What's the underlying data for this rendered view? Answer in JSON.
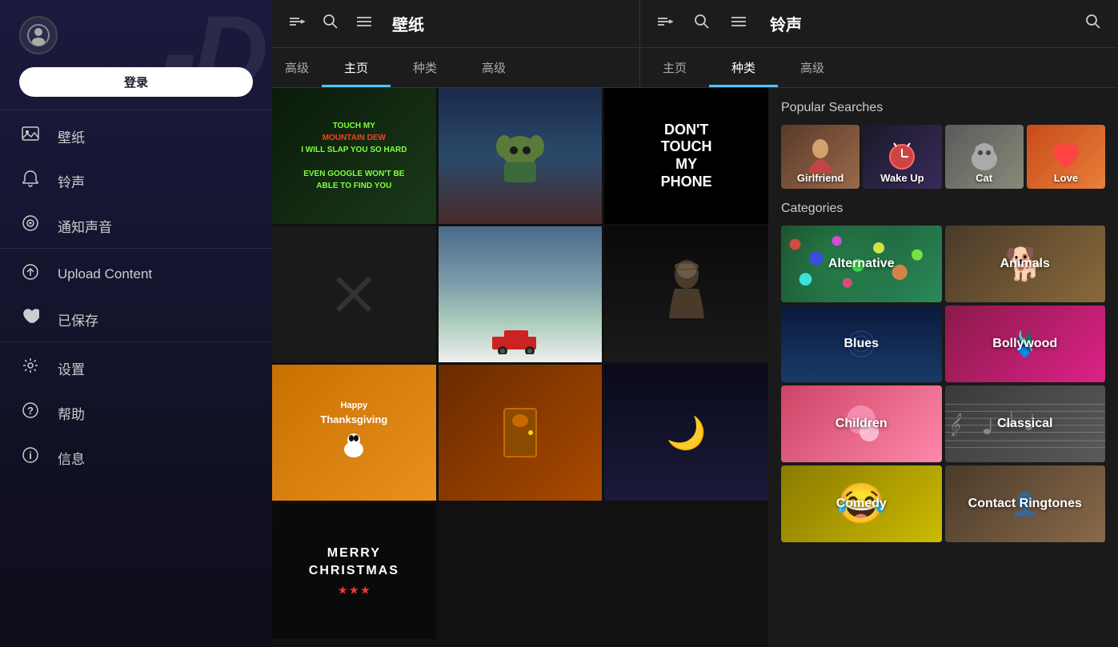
{
  "sidebar": {
    "login_label": "登录",
    "bg_logo": "-D",
    "items": [
      {
        "id": "wallpaper",
        "label": "壁纸",
        "icon": "🖼"
      },
      {
        "id": "ringtone",
        "label": "铃声",
        "icon": "🔔"
      },
      {
        "id": "notification",
        "label": "通知声音",
        "icon": "🔔"
      },
      {
        "id": "upload",
        "label": "Upload Content",
        "icon": "⬆"
      },
      {
        "id": "saved",
        "label": "已保存",
        "icon": "♥"
      },
      {
        "id": "settings",
        "label": "设置",
        "icon": "⚙"
      },
      {
        "id": "help",
        "label": "帮助",
        "icon": "❓"
      },
      {
        "id": "info",
        "label": "信息",
        "icon": "ℹ"
      }
    ]
  },
  "wallpaper_section": {
    "title": "壁纸",
    "tabs": [
      {
        "id": "home",
        "label": "主页",
        "active": true
      },
      {
        "id": "categories",
        "label": "种类",
        "active": false
      },
      {
        "id": "advanced",
        "label": "高级",
        "active": false
      }
    ],
    "extra_tab": "高级"
  },
  "ringtone_section": {
    "title": "铃声",
    "tabs": [
      {
        "id": "home",
        "label": "主页",
        "active": false
      },
      {
        "id": "categories",
        "label": "种类",
        "active": true
      },
      {
        "id": "advanced",
        "label": "高级",
        "active": false
      }
    ]
  },
  "wallpaper_cells": [
    {
      "id": "touch-dew",
      "type": "text",
      "text": "TOUCH MY\nMOUNTAIN DEW\nI WILL SLAP YOU SO HARD\nEVEN GOOGLE WON'T BE\nABLE TO FIND YOU"
    },
    {
      "id": "baby-yoda-xmas",
      "type": "image_placeholder",
      "desc": "Baby Yoda Christmas"
    },
    {
      "id": "dont-touch",
      "type": "text",
      "text": "DON'T\nTOUCH\nMY\nPHONE"
    },
    {
      "id": "x-mark-1",
      "type": "x_mark"
    },
    {
      "id": "snow-scene",
      "type": "image_placeholder",
      "desc": "Snow scene red truck"
    },
    {
      "id": "jesus",
      "type": "image_placeholder",
      "desc": "Jesus portrait"
    },
    {
      "id": "snoopy-thanks",
      "type": "image_placeholder",
      "desc": "Snoopy Thanksgiving"
    },
    {
      "id": "christmas-door",
      "type": "image_placeholder",
      "desc": "Christmas door"
    },
    {
      "id": "moon",
      "type": "image_placeholder",
      "desc": "Moon night scene"
    },
    {
      "id": "merry-christmas",
      "type": "text",
      "text": "MERRY\nCHRISTMAS"
    }
  ],
  "popular_searches": {
    "title": "Popular Searches",
    "items": [
      {
        "id": "girlfriend",
        "label": "Girlfriend"
      },
      {
        "id": "wakeup",
        "label": "Wake Up"
      },
      {
        "id": "cat",
        "label": "Cat"
      },
      {
        "id": "love",
        "label": "Love"
      }
    ]
  },
  "categories": {
    "title": "Categories",
    "items": [
      {
        "id": "alternative",
        "label": "Alternative"
      },
      {
        "id": "animals",
        "label": "Animals"
      },
      {
        "id": "blues",
        "label": "Blues"
      },
      {
        "id": "bollywood",
        "label": "Bollywood"
      },
      {
        "id": "children",
        "label": "Children"
      },
      {
        "id": "classical",
        "label": "Classical"
      },
      {
        "id": "comedy",
        "label": "Comedy"
      },
      {
        "id": "contact-ringtones",
        "label": "Contact Ringtones"
      }
    ]
  }
}
